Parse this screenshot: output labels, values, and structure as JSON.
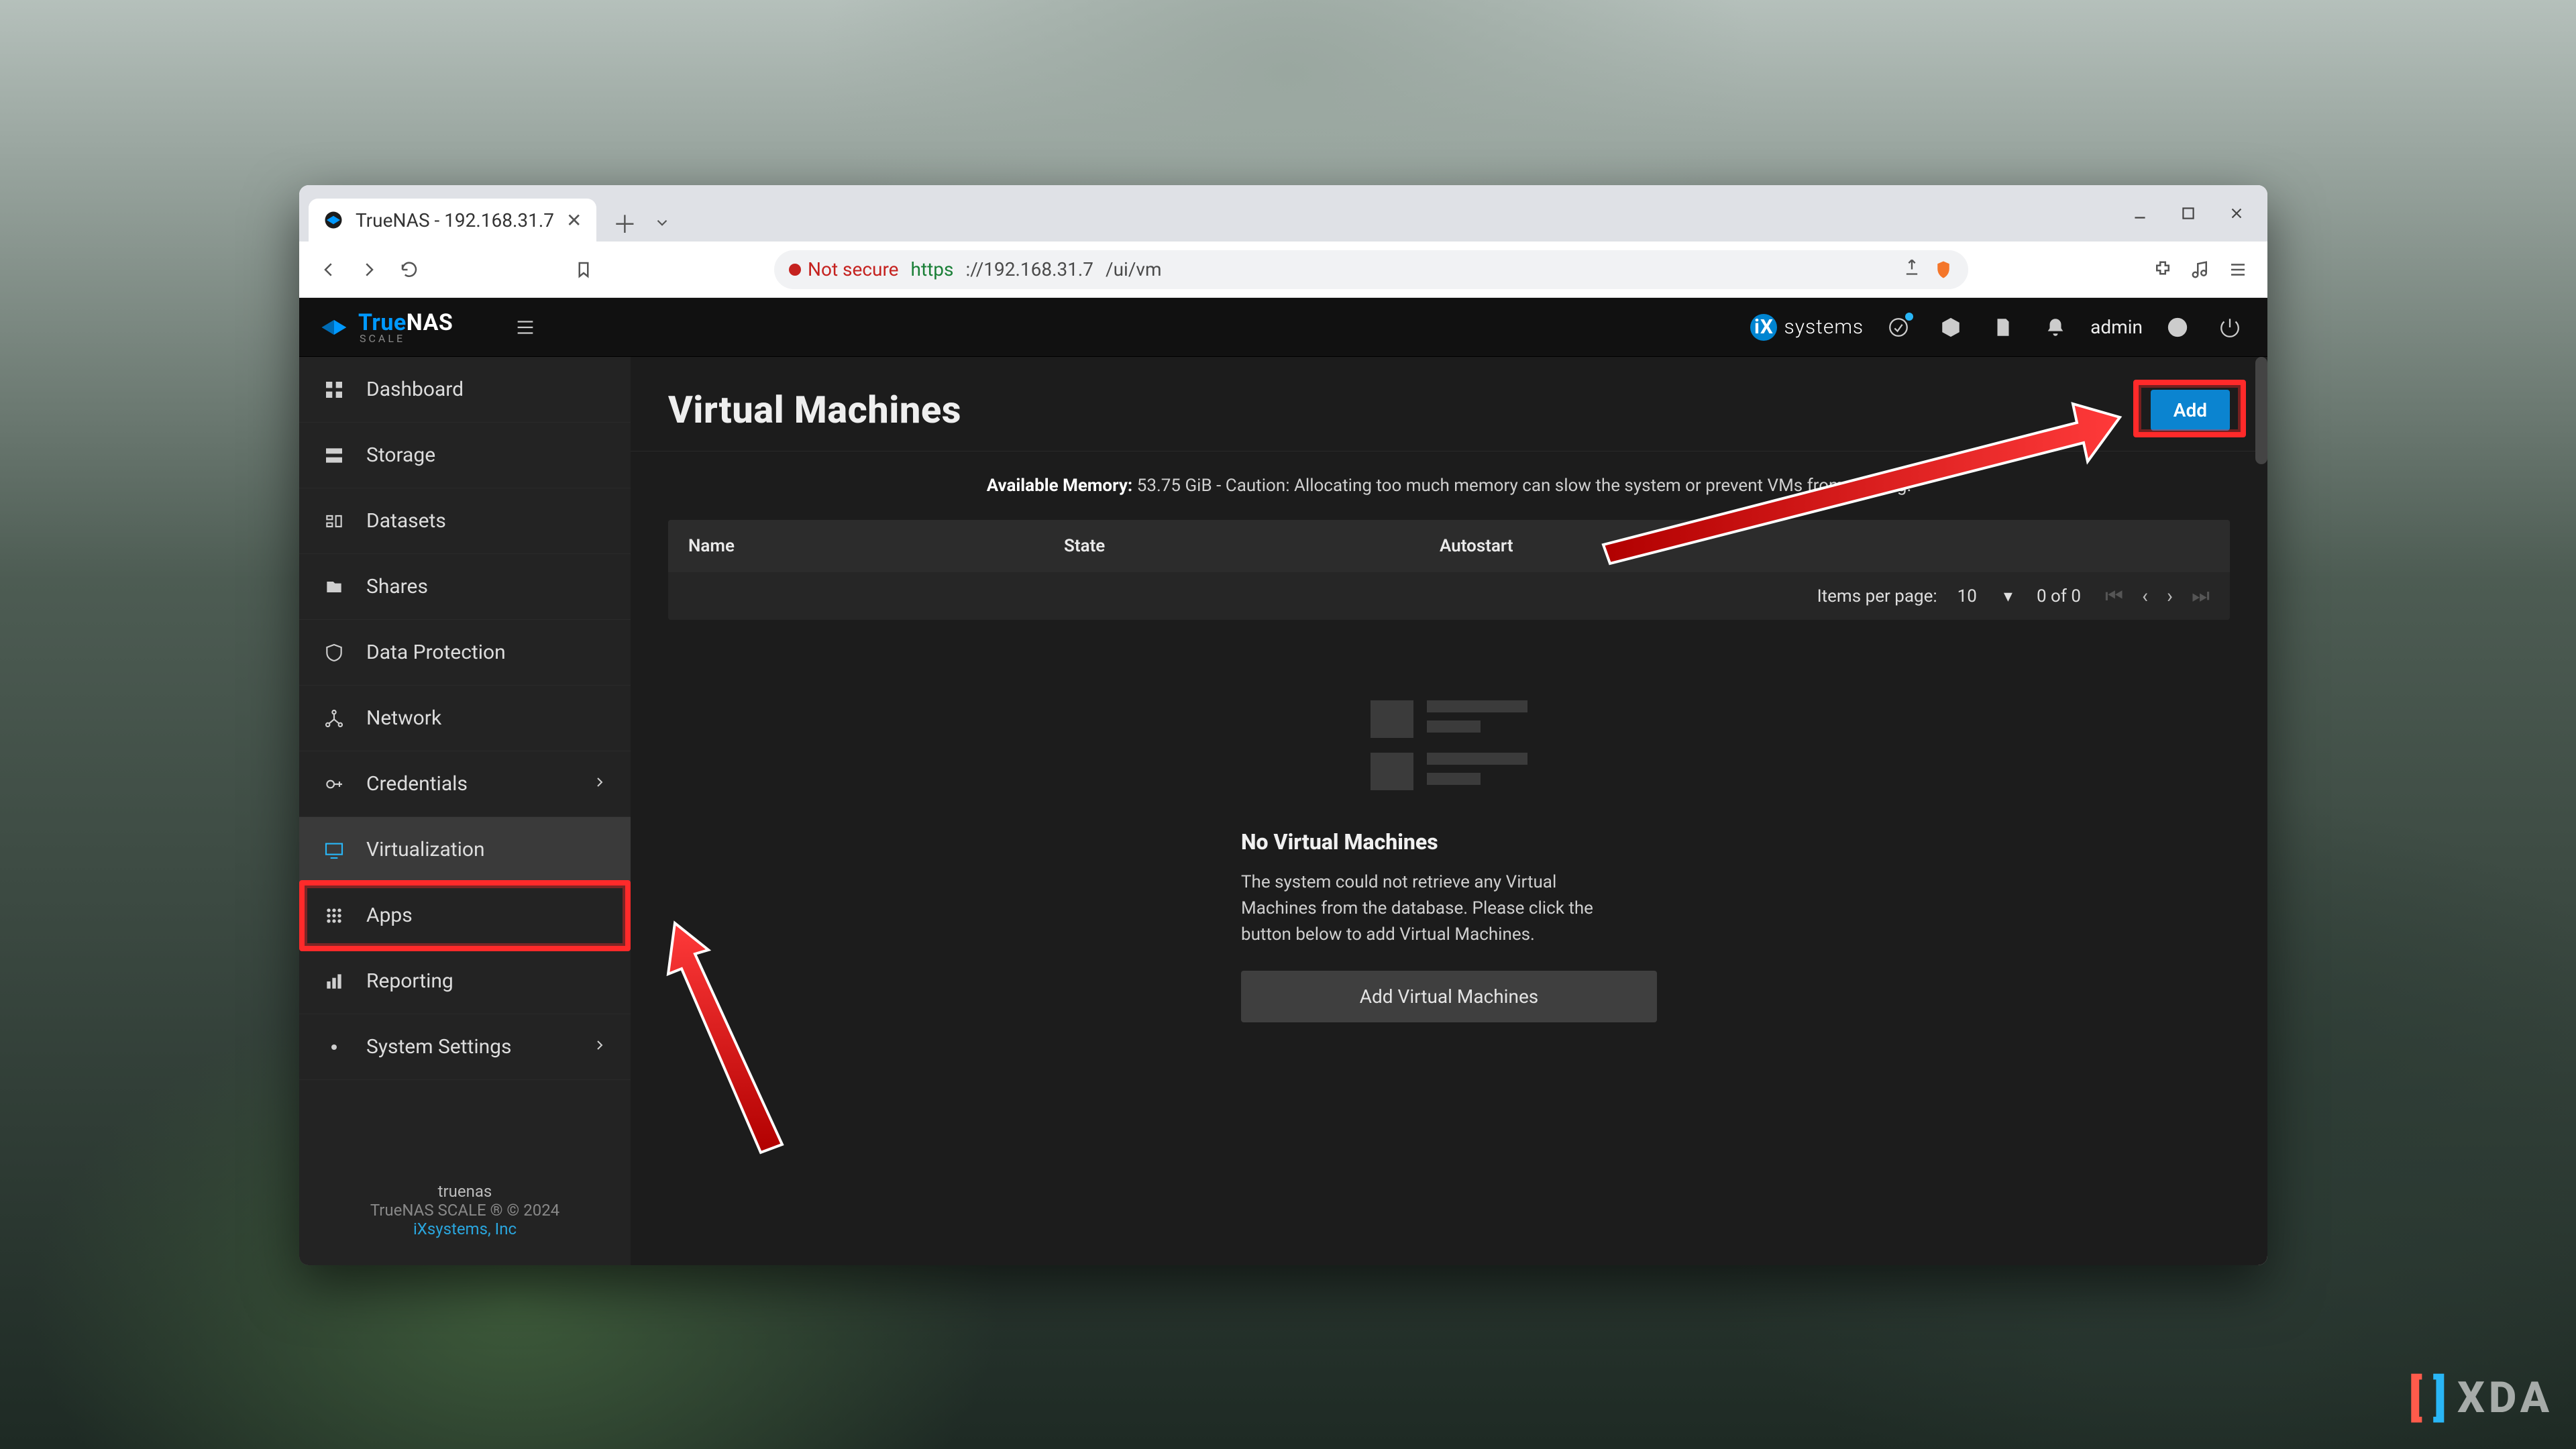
{
  "browser": {
    "tab_title": "TrueNAS - 192.168.31.7",
    "not_secure": "Not secure",
    "protocol": "https",
    "host": "://192.168.31.7",
    "path": "/ui/vm"
  },
  "topbar": {
    "brand_true": "True",
    "brand_nas": "NAS",
    "brand_sub": "SCALE",
    "ix": "systems",
    "user": "admin"
  },
  "sidebar": {
    "items": [
      {
        "label": "Dashboard"
      },
      {
        "label": "Storage"
      },
      {
        "label": "Datasets"
      },
      {
        "label": "Shares"
      },
      {
        "label": "Data Protection"
      },
      {
        "label": "Network"
      },
      {
        "label": "Credentials"
      },
      {
        "label": "Virtualization"
      },
      {
        "label": "Apps"
      },
      {
        "label": "Reporting"
      },
      {
        "label": "System Settings"
      }
    ],
    "footer": {
      "host": "truenas",
      "edition": "TrueNAS SCALE ® © 2024",
      "link": "iXsystems, Inc"
    }
  },
  "page": {
    "title": "Virtual Machines",
    "add": "Add",
    "memory_label": "Available Memory:",
    "memory_value": "53.75 GiB - Caution: Allocating too much memory can slow the system or prevent VMs from running.",
    "cols": {
      "name": "Name",
      "state": "State",
      "autostart": "Autostart"
    },
    "pager": {
      "ipp_label": "Items per page:",
      "ipp_value": "10",
      "range": "0 of 0"
    },
    "empty": {
      "title": "No Virtual Machines",
      "text": "The system could not retrieve any Virtual Machines from the database. Please click the button below to add Virtual Machines.",
      "button": "Add Virtual Machines"
    }
  },
  "watermark": "XDA"
}
